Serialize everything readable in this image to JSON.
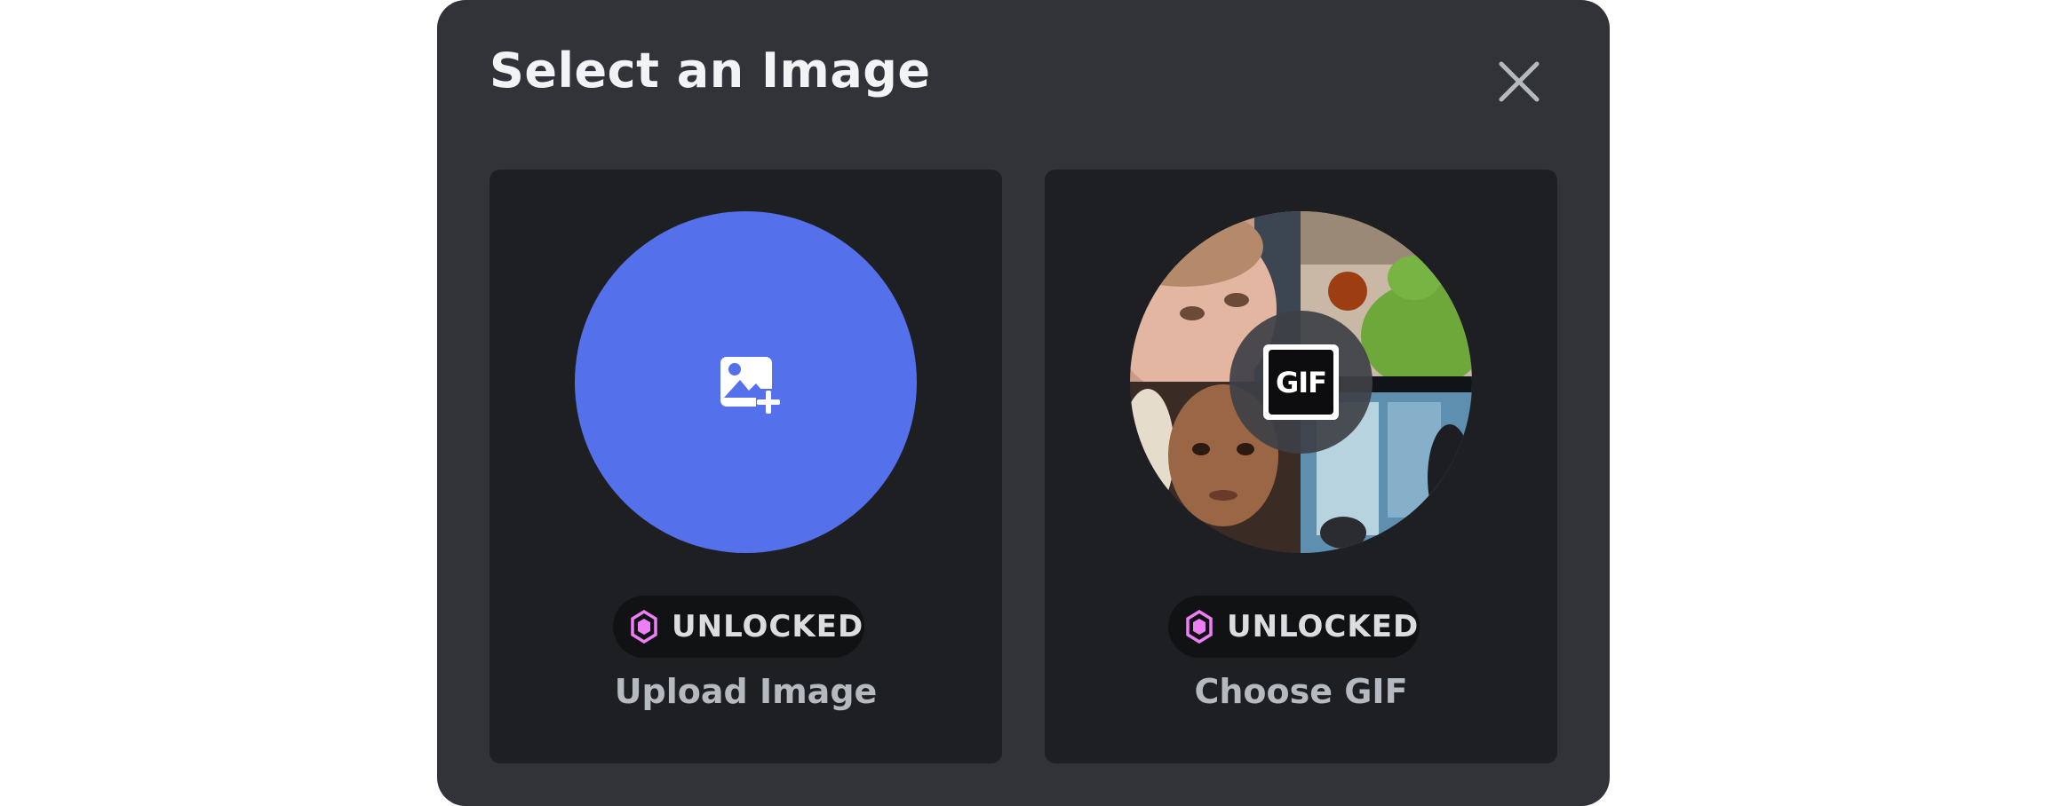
{
  "modal": {
    "title": "Select an Image"
  },
  "options": {
    "upload": {
      "badge": "UNLOCKED",
      "label": "Upload Image"
    },
    "gif": {
      "badge": "UNLOCKED",
      "label": "Choose GIF",
      "tag": "GIF"
    }
  },
  "colors": {
    "modal_background": "#313338",
    "card_background": "#1e1f22",
    "upload_circle": "#5470ea",
    "badge_gem": "#ed7ef5"
  },
  "icons": {
    "close": "close-icon",
    "upload": "image-add-icon",
    "badge": "nitro-gem-icon"
  }
}
